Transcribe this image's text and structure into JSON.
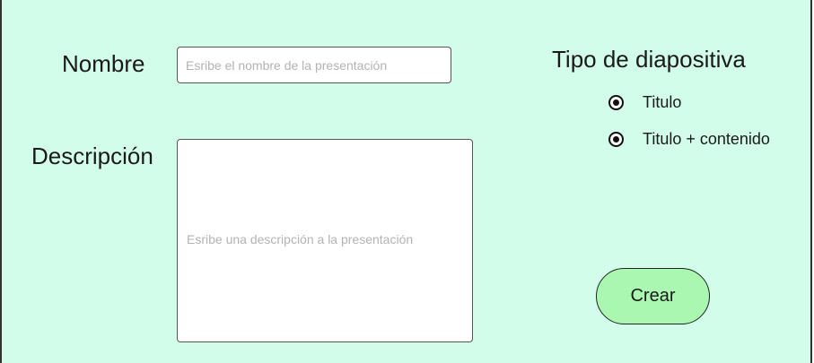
{
  "form": {
    "nombre_label": "Nombre",
    "nombre_placeholder": "Esribe el nombre de la presentación",
    "descripcion_label": "Descripción",
    "descripcion_placeholder": "Esribe una descripción a la presentación",
    "tipo_label": "Tipo de diapositiva",
    "tipo_options": [
      {
        "label": "Titulo",
        "selected": true
      },
      {
        "label": "Titulo + contenido",
        "selected": true
      }
    ],
    "crear_label": "Crear"
  },
  "colors": {
    "background": "#d3fdeb",
    "button": "#aaf7b2"
  }
}
